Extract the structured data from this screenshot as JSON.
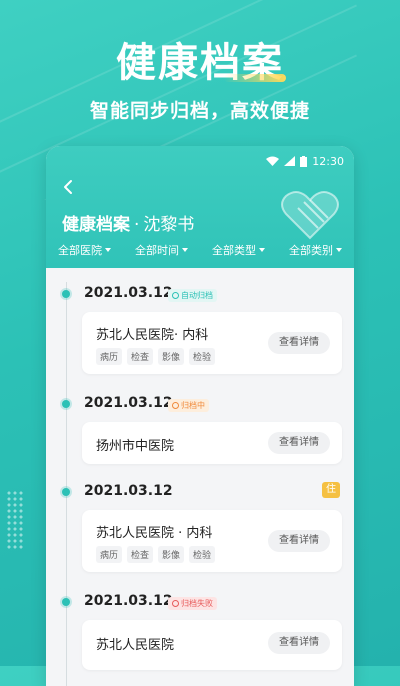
{
  "promo": {
    "title": "健康档案",
    "subtitle": "智能同步归档，高效便捷"
  },
  "status_bar": {
    "time": "12:30",
    "icons": [
      "wifi-icon",
      "signal-icon",
      "battery-icon"
    ]
  },
  "header": {
    "back_icon": "chevron-left-icon",
    "title": "健康档案",
    "separator": "·",
    "patient_name": "沈黎书",
    "decor_icon": "heart-icon"
  },
  "filters": [
    {
      "label": "全部医院"
    },
    {
      "label": "全部时间"
    },
    {
      "label": "全部类型"
    },
    {
      "label": "全部类别"
    }
  ],
  "records": [
    {
      "date": "2021.03.12",
      "status": "自动归档",
      "status_kind": "ok",
      "inpatient_tag": "",
      "hospital": "苏北人民医院·  内科",
      "chips": [
        "病历",
        "检查",
        "影像",
        "检验"
      ],
      "action": "查看详情"
    },
    {
      "date": "2021.03.12",
      "status": "归档中",
      "status_kind": "warn",
      "inpatient_tag": "",
      "hospital": "扬州市中医院",
      "chips": [],
      "action": "查看详情"
    },
    {
      "date": "2021.03.12",
      "status": "",
      "status_kind": "",
      "inpatient_tag": "住",
      "hospital": "苏北人民医院 · 内科",
      "chips": [
        "病历",
        "检查",
        "影像",
        "检验"
      ],
      "action": "查看详情"
    },
    {
      "date": "2021.03.12",
      "status": "归档失败",
      "status_kind": "err",
      "inpatient_tag": "",
      "hospital": "苏北人民医院",
      "chips": [],
      "action": "查看详情"
    }
  ],
  "colors": {
    "accent": "#2cc1b6",
    "warn": "#f08a3c",
    "error": "#e75b5b",
    "inpatient": "#f5c042"
  }
}
